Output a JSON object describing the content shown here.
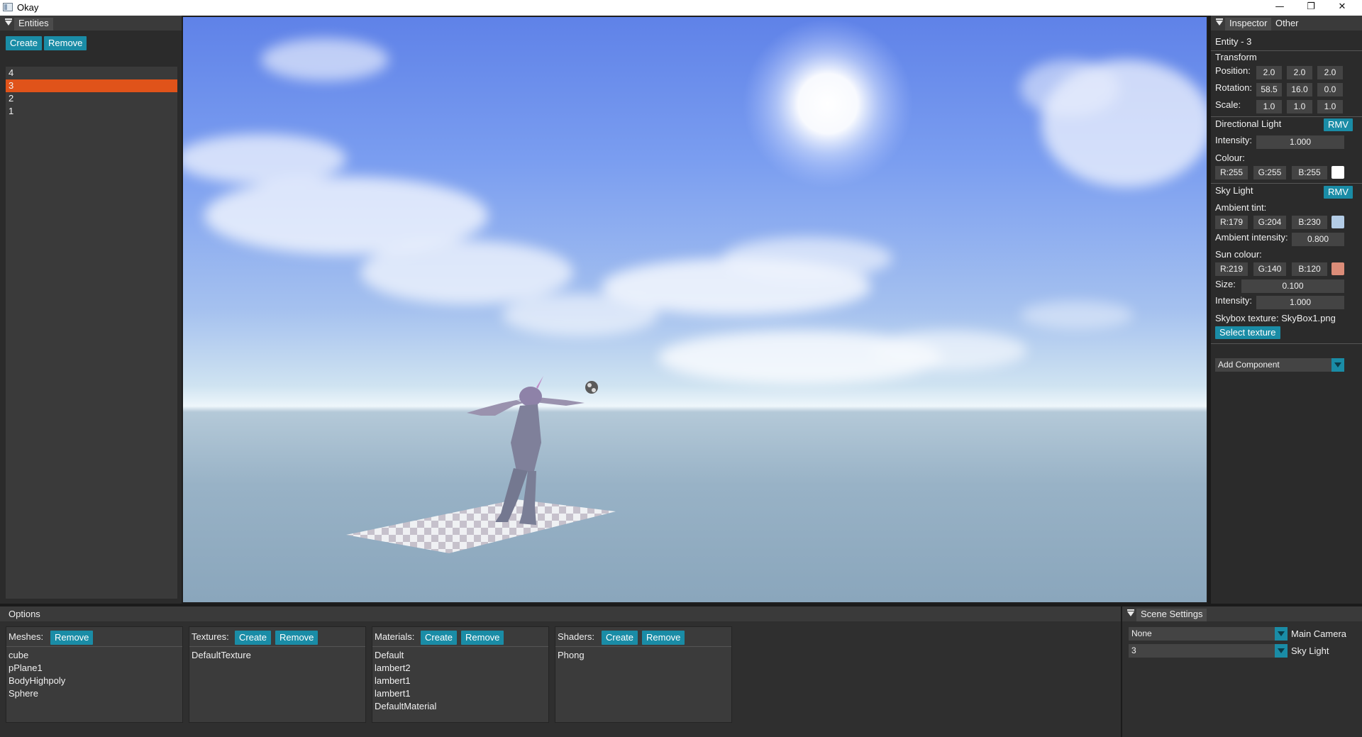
{
  "window": {
    "title": "Okay",
    "controls": {
      "minimize": "—",
      "restore": "❐",
      "close": "✕"
    }
  },
  "entities_panel": {
    "title": "Entities",
    "create_label": "Create",
    "remove_label": "Remove",
    "items": [
      "4",
      "3",
      "2",
      "1"
    ],
    "selected": "3"
  },
  "inspector": {
    "tabs": [
      "Inspector",
      "Other"
    ],
    "entity_title": "Entity - 3",
    "transform": {
      "title": "Transform",
      "position_label": "Position:",
      "position": [
        "2.0",
        "2.0",
        "2.0"
      ],
      "rotation_label": "Rotation:",
      "rotation": [
        "58.5",
        "16.0",
        "0.0"
      ],
      "scale_label": "Scale:",
      "scale": [
        "1.0",
        "1.0",
        "1.0"
      ]
    },
    "directional_light": {
      "title": "Directional Light",
      "rmv_label": "RMV",
      "intensity_label": "Intensity:",
      "intensity": "1.000",
      "colour_label": "Colour:",
      "colour": [
        "R:255",
        "G:255",
        "B:255"
      ],
      "swatch": "#ffffff"
    },
    "sky_light": {
      "title": "Sky Light",
      "rmv_label": "RMV",
      "ambient_tint_label": "Ambient tint:",
      "ambient_tint": [
        "R:179",
        "G:204",
        "B:230"
      ],
      "ambient_swatch": "#b3cce6",
      "ambient_intensity_label": "Ambient intensity:",
      "ambient_intensity": "0.800",
      "sun_colour_label": "Sun colour:",
      "sun_colour": [
        "R:219",
        "G:140",
        "B:120"
      ],
      "sun_swatch": "#db8c78",
      "size_label": "Size:",
      "size": "0.100",
      "intensity_label": "Intensity:",
      "intensity": "1.000",
      "skybox_label": "Skybox texture: SkyBox1.png",
      "select_texture_label": "Select texture"
    },
    "add_component_label": "Add Component"
  },
  "options": {
    "title": "Options",
    "meshes": {
      "label": "Meshes:",
      "remove_label": "Remove",
      "items": [
        "cube",
        "pPlane1",
        "BodyHighpoly",
        "Sphere"
      ]
    },
    "textures": {
      "label": "Textures:",
      "create_label": "Create",
      "remove_label": "Remove",
      "items": [
        "DefaultTexture"
      ]
    },
    "materials": {
      "label": "Materials:",
      "create_label": "Create",
      "remove_label": "Remove",
      "items": [
        "Default",
        "lambert2",
        "lambert1",
        "lambert1",
        "DefaultMaterial"
      ]
    },
    "shaders": {
      "label": "Shaders:",
      "create_label": "Create",
      "remove_label": "Remove",
      "items": [
        "Phong"
      ]
    }
  },
  "scene_settings": {
    "title": "Scene Settings",
    "main_camera_value": "None",
    "main_camera_label": "Main Camera",
    "sky_light_value": "3",
    "sky_light_label": "Sky Light"
  },
  "colors": {
    "accent": "#1a8ca6",
    "selection": "#e0531a",
    "panel_bg": "#2b2b2b"
  }
}
